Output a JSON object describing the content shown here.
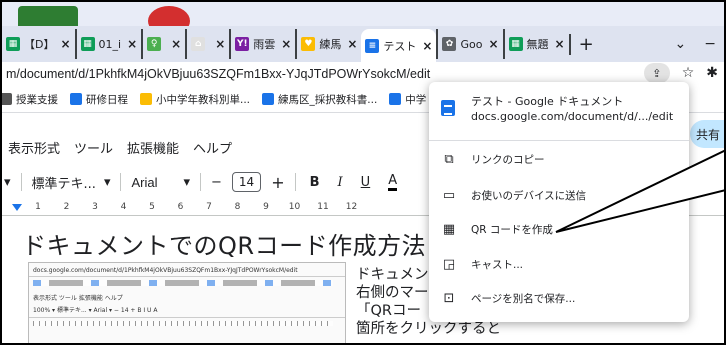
{
  "tabs": [
    {
      "title": "【D】",
      "fav_color": "#0f9d58",
      "fav_glyph": "▦"
    },
    {
      "title": "01_i",
      "fav_color": "#0f9d58",
      "fav_glyph": "▦"
    },
    {
      "title": "",
      "fav_color": "#4caf50",
      "fav_glyph": "♀"
    },
    {
      "title": "",
      "fav_color": "#e0e0e0",
      "fav_glyph": "⌂"
    },
    {
      "title": "雨雲",
      "fav_color": "#7b1fa2",
      "fav_glyph": "Y!"
    },
    {
      "title": "練馬",
      "fav_color": "#fbbc04",
      "fav_glyph": "♥"
    },
    {
      "title": "テスト",
      "fav_color": "#1a73e8",
      "fav_glyph": "≡",
      "active": true
    },
    {
      "title": "Goo",
      "fav_color": "#5f6368",
      "fav_glyph": "✿"
    },
    {
      "title": "無題",
      "fav_color": "#0f9d58",
      "fav_glyph": "▦"
    }
  ],
  "tab_close": "×",
  "new_tab": "+",
  "address": {
    "url": "m/document/d/1PkhfkM4jOkVBjuu63SZQFm1Bxx-YJqJTdPOWrYsokcM/edit",
    "star": "☆",
    "ext": "✱"
  },
  "bookmarks": [
    {
      "label": "授業支援",
      "color": "#555"
    },
    {
      "label": "研修日程",
      "color": "#1a73e8"
    },
    {
      "label": "小中学年教科別単...",
      "color": "#fbbc04"
    },
    {
      "label": "練馬区_採択教科書...",
      "color": "#1a73e8"
    },
    {
      "label": "中学",
      "color": "#1a73e8"
    }
  ],
  "docs": {
    "menus": [
      "表示形式",
      "ツール",
      "拡張機能",
      "ヘルプ"
    ],
    "style": "標準テキ...",
    "font": "Arial",
    "minus": "−",
    "size": "14",
    "plus": "+",
    "bold": "B",
    "italic": "I",
    "underline": "U",
    "color": "A",
    "share": "共有",
    "ruler_ticks": [
      "1",
      "2",
      "3",
      "4",
      "5",
      "6",
      "7",
      "8",
      "9",
      "10",
      "11",
      "12"
    ],
    "title": "ドキュメントでのQRコード作成方法",
    "body": "ドキュメント\n右側のマーク\n「QRコー\n箇所をクリックすると",
    "thumb_rows": [
      "docs.google.com/document/d/1PkhfkM4jOkVBjuu63SZQFm1Bxx-YJqJTdPOWrYsokcM/edit",
      "表示形式  ツール  拡張機能  ヘルプ",
      "100%  ▾  標準テキ...  ▾  Arial  ▾  −  14  +  B  I  U  A"
    ]
  },
  "menu": {
    "doc_title": "テスト - Google ドキュメント",
    "doc_url": "docs.google.com/document/d/.../edit",
    "items": [
      {
        "label": "リンクのコピー",
        "icon": "⧉"
      },
      {
        "label": "お使いのデバイスに送信",
        "icon": "▭"
      },
      {
        "label": "QR コードを作成",
        "icon": "▦"
      },
      {
        "label": "キャスト...",
        "icon": "◲"
      },
      {
        "label": "ページを別名で保存...",
        "icon": "⊡"
      }
    ]
  }
}
